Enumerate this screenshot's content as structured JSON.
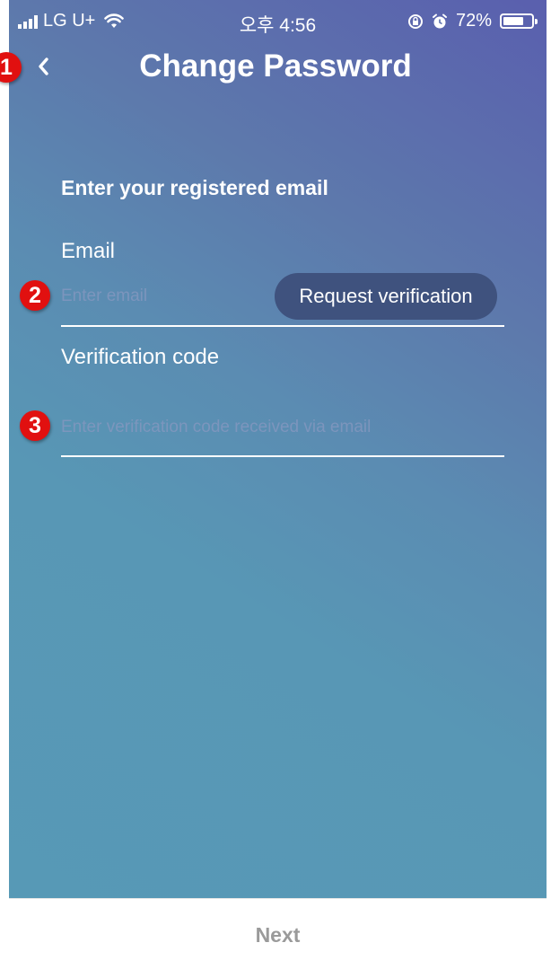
{
  "status_bar": {
    "carrier": "LG U+",
    "time": "오후 4:56",
    "battery": "72%",
    "battery_level": 0.72
  },
  "header": {
    "title": "Change Password",
    "back_icon": "chevron-left-icon"
  },
  "form": {
    "section_title": "Enter your registered email",
    "email": {
      "label": "Email",
      "placeholder": "Enter email",
      "value": ""
    },
    "request_button": "Request verification",
    "code": {
      "label": "Verification code",
      "placeholder": "Enter verification code received via email",
      "value": ""
    }
  },
  "footer": {
    "next_label": "Next"
  },
  "annotations": [
    "1",
    "2",
    "3"
  ],
  "colors": {
    "gradient_top": "#5a5fae",
    "gradient_bottom": "#5799b6",
    "request_button_bg": "#3f527e",
    "badge_red": "#e11010",
    "next_disabled": "#9a9a9a"
  }
}
